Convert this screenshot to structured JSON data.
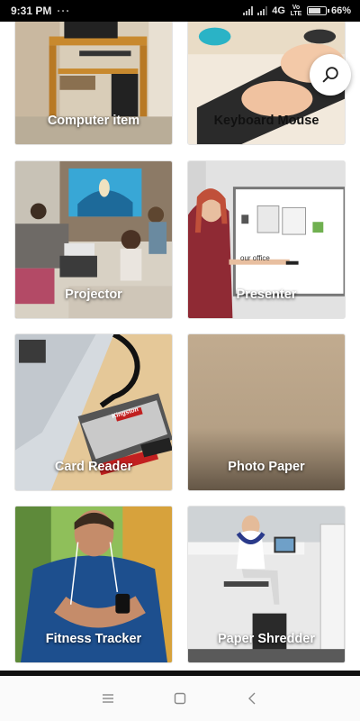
{
  "status_bar": {
    "time": "9:31 PM",
    "network": "4G",
    "volte": "Vo LTE",
    "battery": "66%"
  },
  "categories": [
    {
      "label": "Computer item"
    },
    {
      "label": "Keyboard Mouse"
    },
    {
      "label": "Projector"
    },
    {
      "label": "Presenter"
    },
    {
      "label": "Card Reader"
    },
    {
      "label": "Photo Paper"
    },
    {
      "label": "Fitness Tracker"
    },
    {
      "label": "Paper Shredder"
    }
  ],
  "presenter_board_text": "our office",
  "card_reader_brand": "Kingston",
  "nav": {
    "menu_icon": "menu-icon",
    "home_icon": "square-home-icon",
    "back_icon": "back-chevron-icon"
  }
}
